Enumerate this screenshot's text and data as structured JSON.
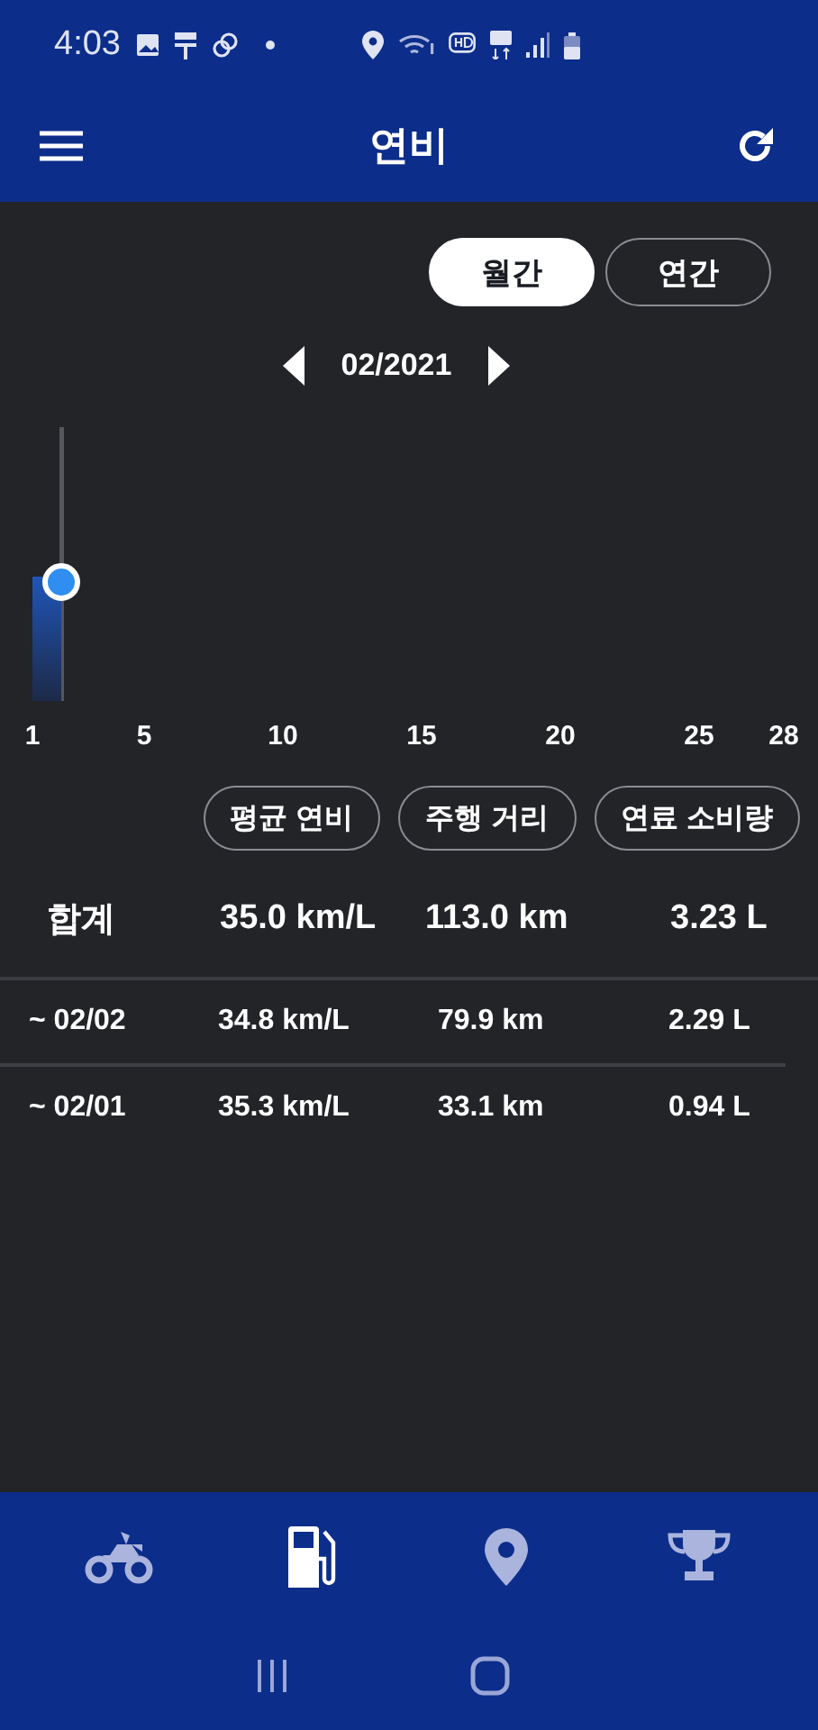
{
  "status_bar": {
    "time": "4:03"
  },
  "app_bar": {
    "title": "연비"
  },
  "period_tabs": [
    {
      "label": "월간",
      "selected": true
    },
    {
      "label": "연간",
      "selected": false
    }
  ],
  "month": "02/2021",
  "chart": {
    "x_labels": [
      "1",
      "5",
      "10",
      "15",
      "20",
      "25",
      "28"
    ]
  },
  "metric_buttons": [
    {
      "label": "평균 연비",
      "selected": false
    },
    {
      "label": "주행 거리",
      "selected": false
    },
    {
      "label": "연료 소비량",
      "selected": false
    }
  ],
  "summary": {
    "label": "합계",
    "values": [
      "35.0 km/L",
      "113.0 km",
      "3.23 L"
    ]
  },
  "rows": [
    {
      "date": "~ 02/02",
      "values": [
        "34.8 km/L",
        "79.9 km",
        "2.29 L"
      ]
    },
    {
      "date": "~ 02/01",
      "values": [
        "35.3 km/L",
        "33.1 km",
        "0.94 L"
      ]
    }
  ],
  "bottom_nav": [
    {
      "kind": "motorcycle",
      "selected": false
    },
    {
      "kind": "fuel",
      "selected": true
    },
    {
      "kind": "location",
      "selected": false
    },
    {
      "kind": "trophy",
      "selected": false
    }
  ]
}
